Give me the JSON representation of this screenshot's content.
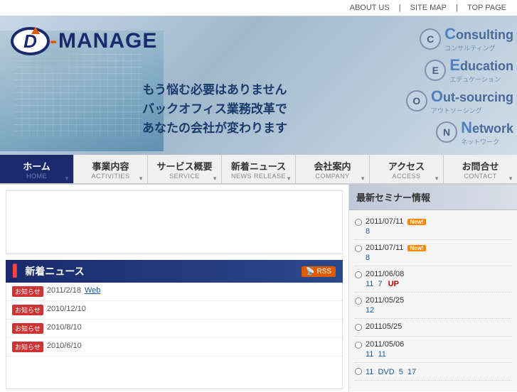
{
  "topnav": {
    "items": [
      "ABOUT US",
      "SITE MAP",
      "TOP PAGE"
    ]
  },
  "logo": {
    "d": "D",
    "dash": "-",
    "text": "MANAGE"
  },
  "hero": {
    "tagline1": "もう悩む必要はありません",
    "tagline2": "バックオフィス業務改革で",
    "tagline3": "あなたの会社が変わります"
  },
  "services": [
    {
      "letter": "C",
      "main": "onsulting",
      "sub": "コンサルティング"
    },
    {
      "letter": "E",
      "main": "ducation",
      "sub": "エデュケーション"
    },
    {
      "letter": "O",
      "main": "ut-sourcing",
      "sub": "アウトソーシング"
    },
    {
      "letter": "N",
      "main": "etwork",
      "sub": "ネットワーク"
    }
  ],
  "mainnav": [
    {
      "jp": "ホーム",
      "en": "HOME",
      "active": true
    },
    {
      "jp": "事業内容",
      "en": "ACTIVITIES",
      "active": false
    },
    {
      "jp": "サービス概要",
      "en": "SERVICE",
      "active": false
    },
    {
      "jp": "新着ニュース",
      "en": "NEWS RELEASE",
      "active": false
    },
    {
      "jp": "会社案内",
      "en": "COMPANY",
      "active": false
    },
    {
      "jp": "アクセス",
      "en": "ACCESS",
      "active": false
    },
    {
      "jp": "お問合せ",
      "en": "CONTACT",
      "active": false
    }
  ],
  "news": {
    "title": "新着ニュース",
    "rss_label": "RSS",
    "items": [
      {
        "badge": "お知らせ",
        "date": "2011/2/18",
        "link": "Web"
      },
      {
        "badge": "お知らせ",
        "date": "2010/12/10",
        "link": ""
      },
      {
        "badge": "お知らせ",
        "date": "2010/8/10",
        "link": ""
      },
      {
        "badge": "お知らせ",
        "date": "2010/6/10",
        "link": ""
      }
    ]
  },
  "seminar": {
    "title": "最新セミナー情報",
    "items": [
      {
        "date": "2011/07/11",
        "is_new": true,
        "links": [
          {
            "text": "8",
            "url": "#"
          }
        ]
      },
      {
        "date": "2011/07/11",
        "is_new": true,
        "links": [
          {
            "text": "8",
            "url": "#"
          }
        ]
      },
      {
        "date": "2011/06/08",
        "is_new": false,
        "links": [
          {
            "text": "11",
            "url": "#"
          },
          {
            "text": "7",
            "url": "#"
          },
          {
            "text": "UP",
            "badge": true
          }
        ]
      },
      {
        "date": "2011/05/25",
        "is_new": false,
        "links": [
          {
            "text": "12",
            "url": "#"
          }
        ]
      },
      {
        "date": "201105/25",
        "is_new": false,
        "links": []
      },
      {
        "date": "2011/05/06",
        "is_new": false,
        "links": [
          {
            "text": "11",
            "url": "#"
          },
          {
            "text": "11",
            "url": "#"
          }
        ]
      },
      {
        "date": "",
        "is_new": false,
        "links": [
          {
            "text": "11",
            "url": "#"
          },
          {
            "text": "DVD",
            "url": "#"
          },
          {
            "text": "5",
            "url": "#"
          },
          {
            "text": "17",
            "url": "#"
          }
        ]
      }
    ]
  }
}
